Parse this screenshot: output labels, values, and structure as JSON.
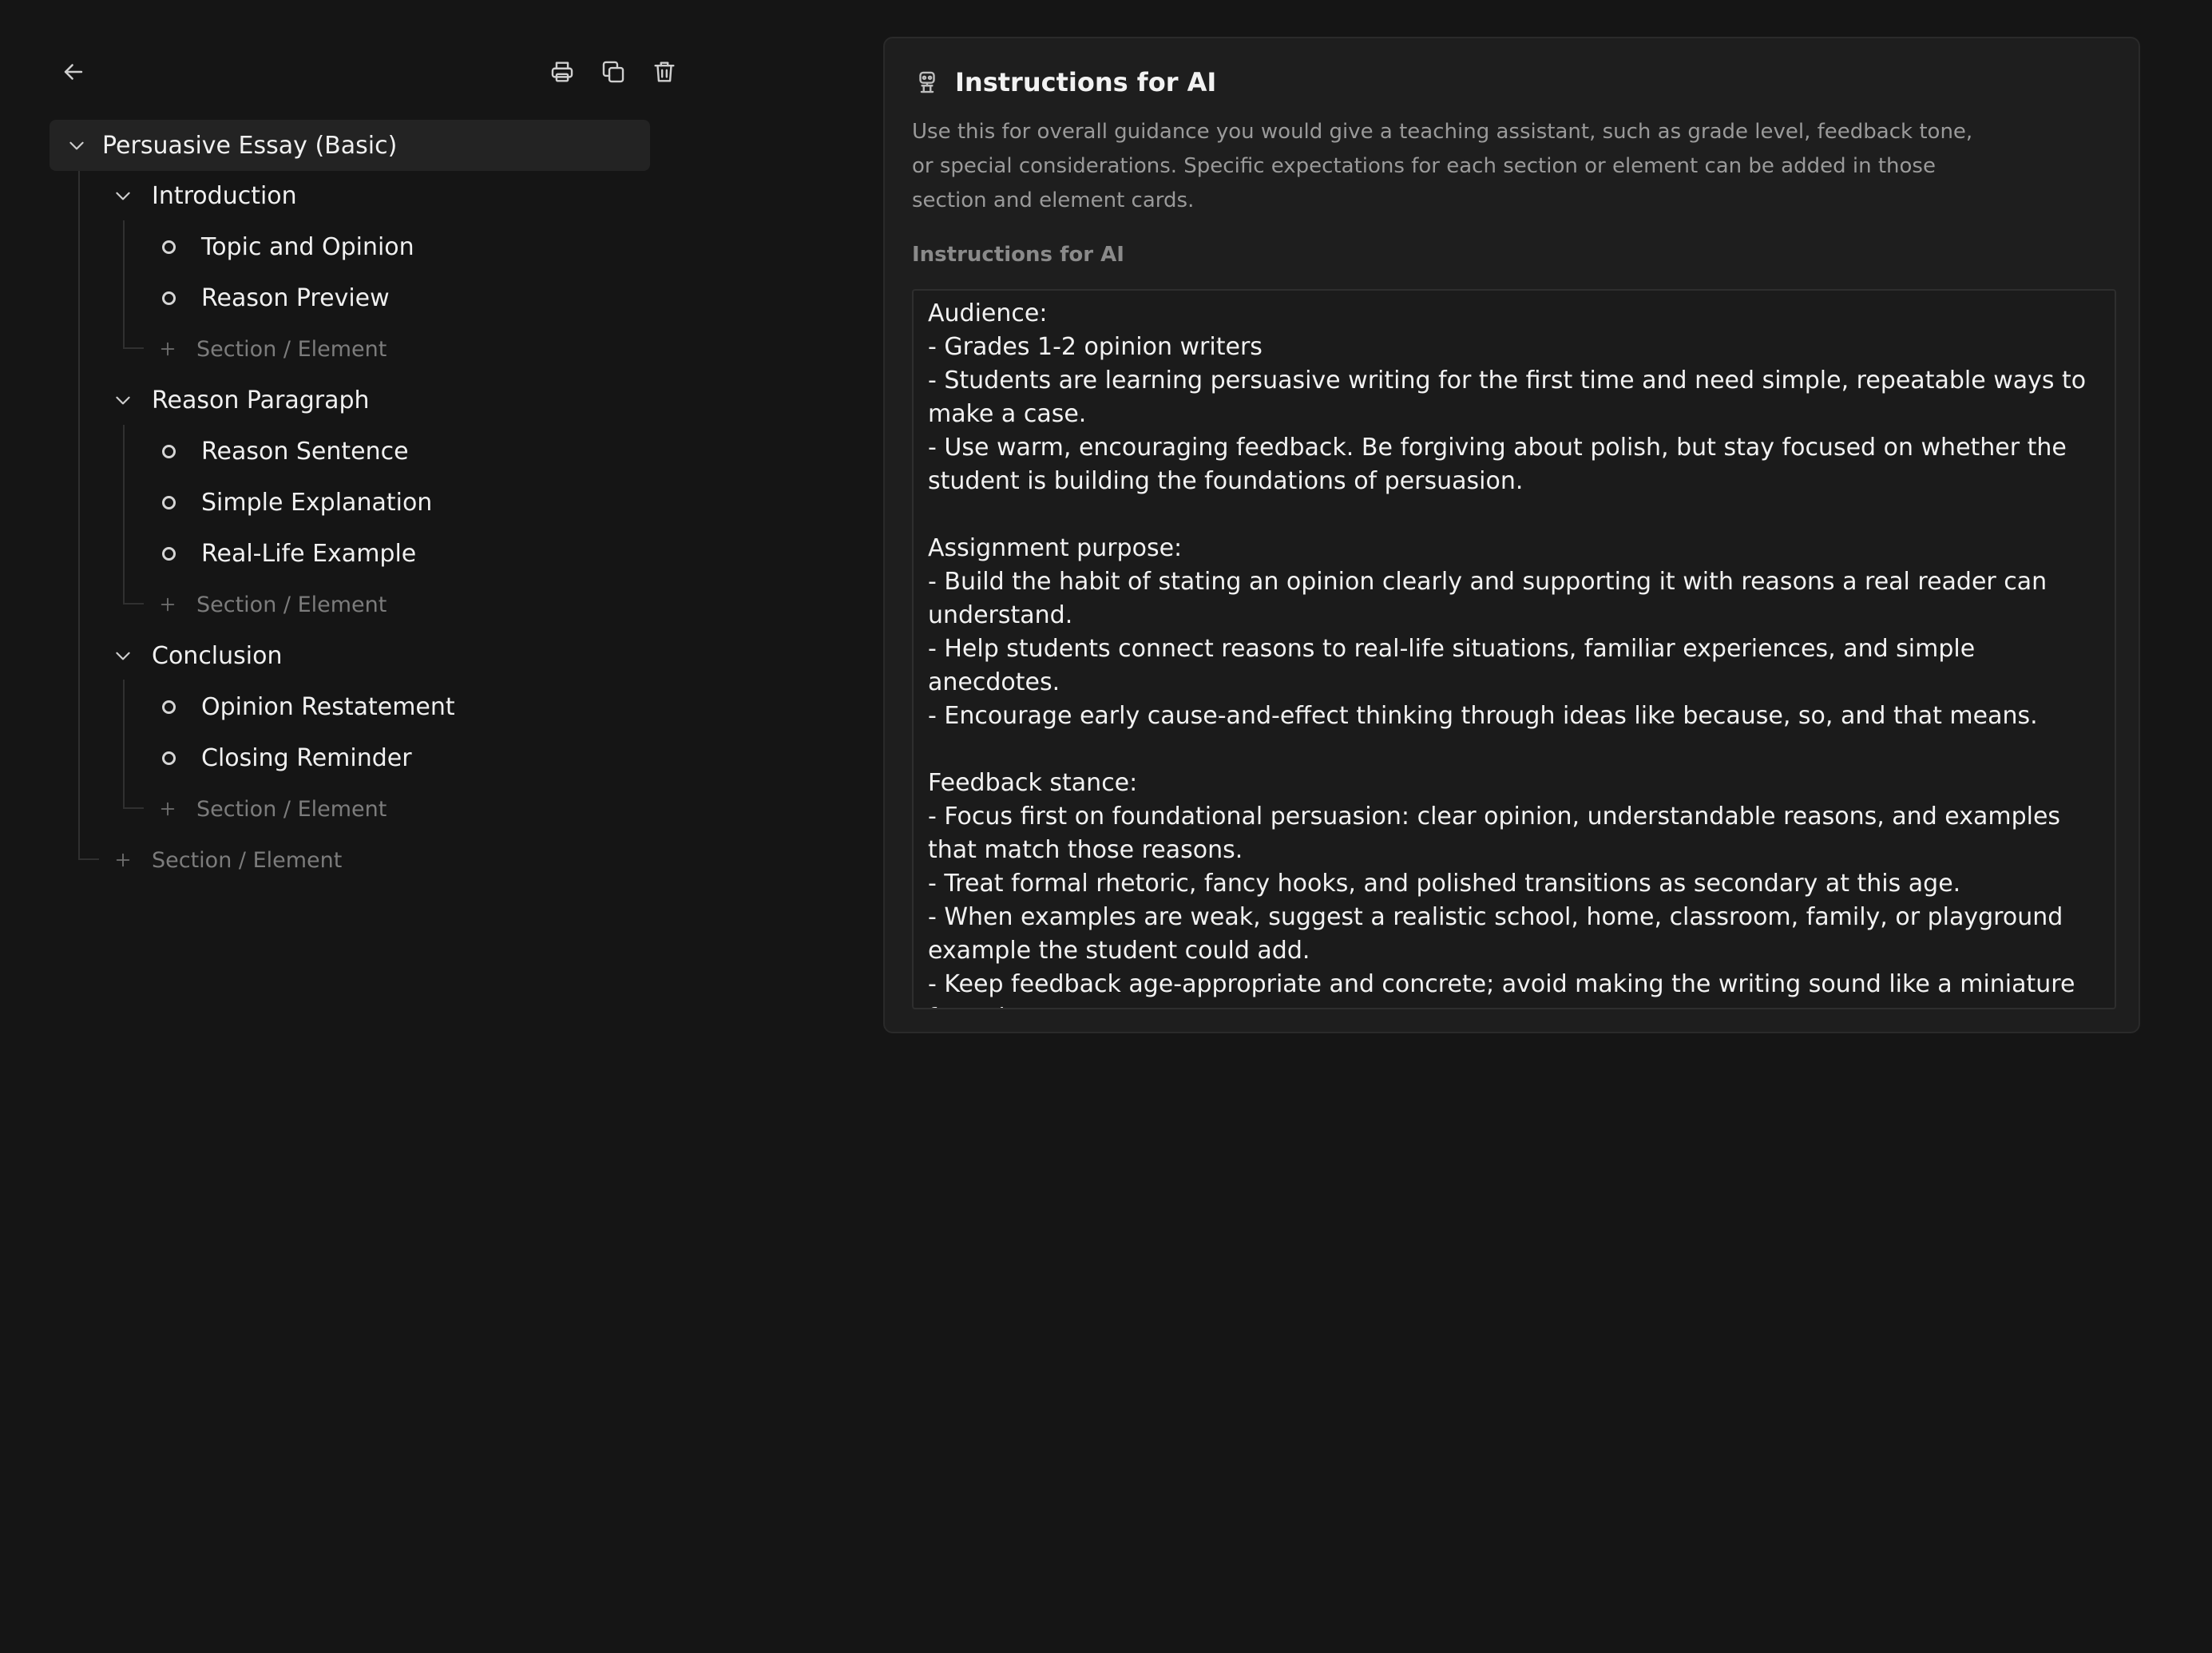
{
  "toolbar": {
    "back_icon": "arrow-left-icon",
    "print_icon": "printer-icon",
    "copy_icon": "copy-icon",
    "delete_icon": "trash-icon"
  },
  "tree": {
    "root": {
      "label": "Persuasive Essay (Basic)"
    },
    "sections": [
      {
        "label": "Introduction",
        "elements": [
          "Topic and Opinion",
          "Reason Preview"
        ],
        "add_label": "Section / Element"
      },
      {
        "label": "Reason Paragraph",
        "elements": [
          "Reason Sentence",
          "Simple Explanation",
          "Real-Life Example"
        ],
        "add_label": "Section / Element"
      },
      {
        "label": "Conclusion",
        "elements": [
          "Opinion Restatement",
          "Closing Reminder"
        ],
        "add_label": "Section / Element"
      }
    ],
    "root_add_label": "Section / Element"
  },
  "panel": {
    "icon": "robot-icon",
    "title": "Instructions for AI",
    "description": "Use this for overall guidance you would give a teaching assistant, such as grade level, feedback tone, or special considerations. Specific expectations for each section or element can be added in those section and element cards.",
    "field_label": "Instructions for AI",
    "field_value": "Audience:\n- Grades 1-2 opinion writers\n- Students are learning persuasive writing for the first time and need simple, repeatable ways to make a case.\n- Use warm, encouraging feedback. Be forgiving about polish, but stay focused on whether the student is building the foundations of persuasion.\n\nAssignment purpose:\n- Build the habit of stating an opinion clearly and supporting it with reasons a real reader can understand.\n- Help students connect reasons to real-life situations, familiar experiences, and simple anecdotes.\n- Encourage early cause-and-effect thinking through ideas like because, so, and that means.\n\nFeedback stance:\n- Focus first on foundational persuasion: clear opinion, understandable reasons, and examples that match those reasons.\n- Treat formal rhetoric, fancy hooks, and polished transitions as secondary at this age.\n- When examples are weak, suggest a realistic school, home, classroom, family, or playground example the student could add.\n- Keep feedback age-appropriate and concrete; avoid making the writing sound like a miniature formal essay."
  },
  "colors": {
    "background": "#151515",
    "panel": "#1e1e1e",
    "selected_row": "#232323",
    "text": "#f0f0f0",
    "muted": "#7c7c7c"
  }
}
